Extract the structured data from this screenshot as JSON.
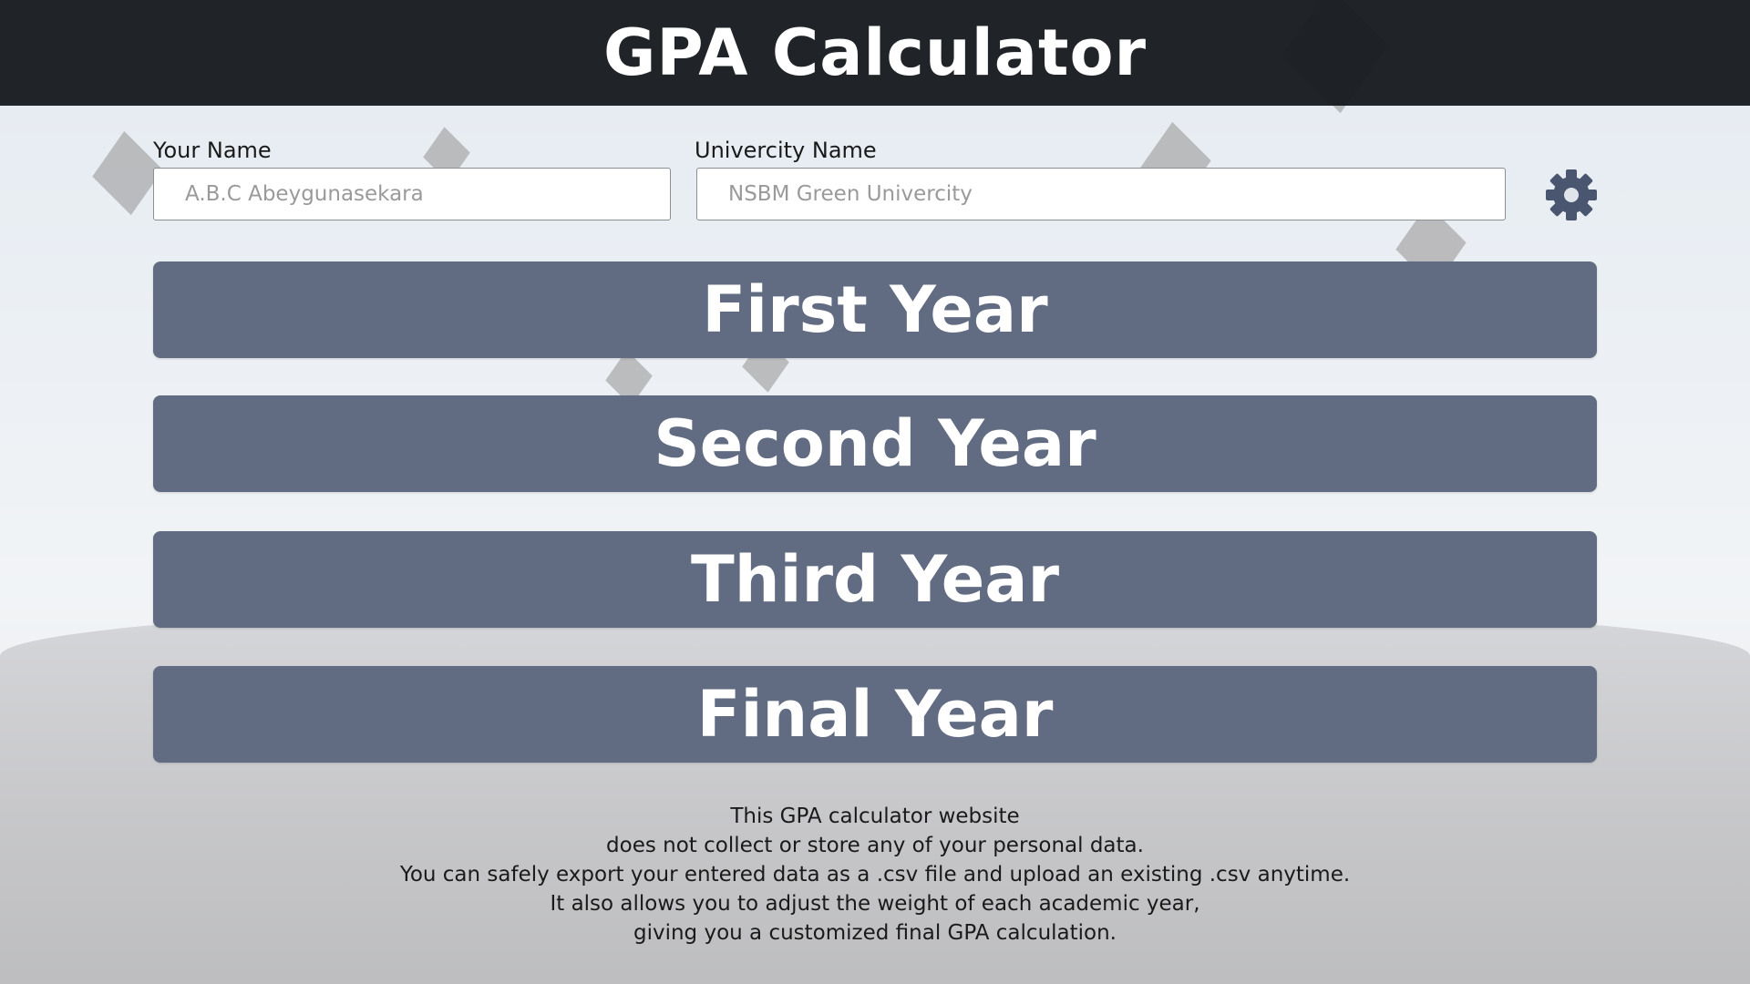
{
  "header": {
    "title": "GPA Calculator"
  },
  "form": {
    "name_label": "Your Name",
    "name_placeholder": "A.B.C Abeygunasekara",
    "university_label": "Univercity Name",
    "university_placeholder": "NSBM Green Univercity",
    "settings_icon": "gear-icon"
  },
  "years": [
    {
      "label": "First Year"
    },
    {
      "label": "Second Year"
    },
    {
      "label": "Third Year"
    },
    {
      "label": "Final Year"
    }
  ],
  "info": {
    "lines": [
      "This GPA calculator website",
      "does not collect or store any of your personal data.",
      "You can safely export your entered data as a .csv file and upload an existing .csv anytime.",
      "It also allows you to adjust the weight of each academic year,",
      "giving you a customized final GPA calculation."
    ]
  },
  "colors": {
    "header_bg": "#181a1e",
    "button_bg": "#616c82",
    "gear_color": "#4a5670"
  }
}
